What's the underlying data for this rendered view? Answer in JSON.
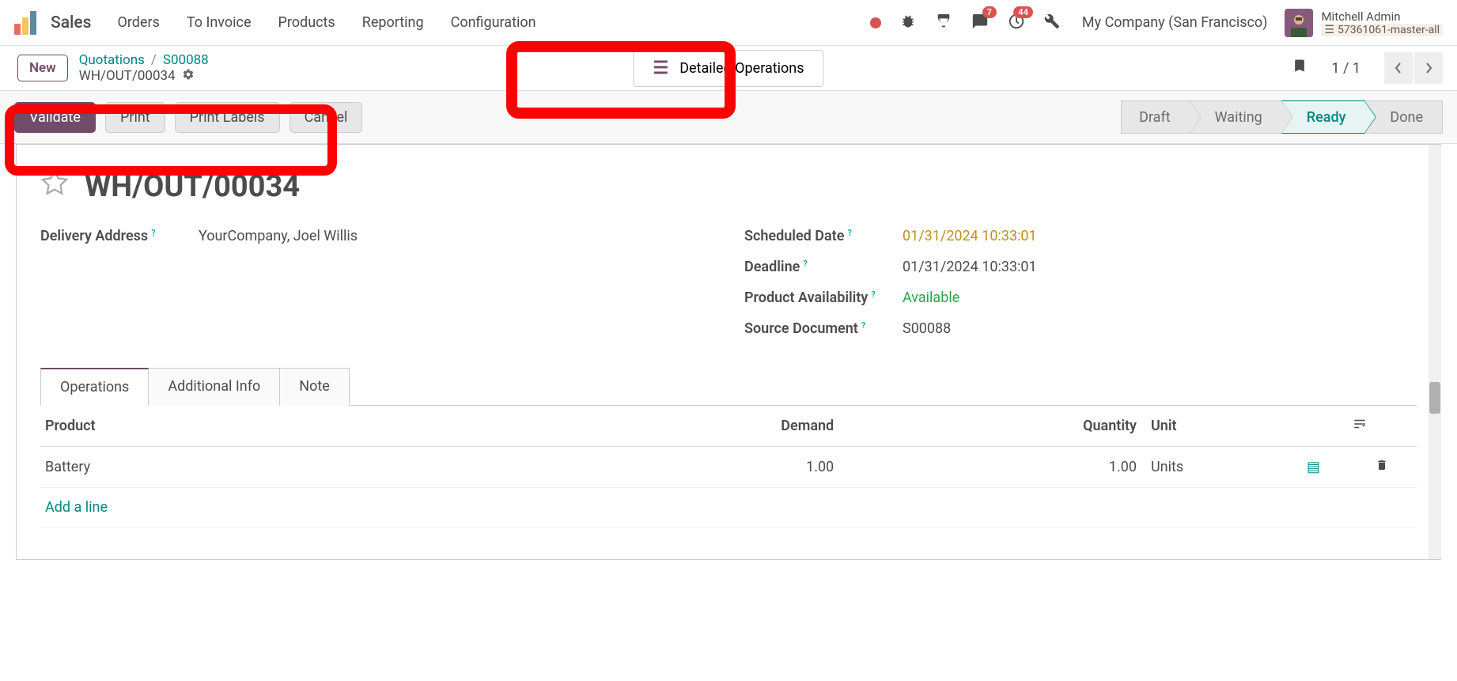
{
  "nav": {
    "app_title": "Sales",
    "menu": [
      "Orders",
      "To Invoice",
      "Products",
      "Reporting",
      "Configuration"
    ],
    "company": "My Company (San Francisco)",
    "badges": {
      "messaging": "7",
      "activities": "44"
    },
    "user": {
      "name": "Mitchell Admin",
      "db": "57361061-master-all"
    }
  },
  "control": {
    "new_btn": "New",
    "breadcrumb": {
      "quotations": "Quotations",
      "order": "S00088",
      "record": "WH/OUT/00034"
    },
    "stat_button": "Detailed Operations",
    "pager": "1 / 1"
  },
  "actions": {
    "validate": "Validate",
    "print": "Print",
    "print_labels": "Print Labels",
    "cancel": "Cancel"
  },
  "status": {
    "draft": "Draft",
    "waiting": "Waiting",
    "ready": "Ready",
    "done": "Done"
  },
  "form": {
    "title": "WH/OUT/00034",
    "delivery_address_label": "Delivery Address",
    "delivery_address": "YourCompany, Joel Willis",
    "scheduled_date_label": "Scheduled Date",
    "scheduled_date": "01/31/2024 10:33:01",
    "deadline_label": "Deadline",
    "deadline": "01/31/2024 10:33:01",
    "availability_label": "Product Availability",
    "availability": "Available",
    "source_label": "Source Document",
    "source": "S00088"
  },
  "tabs": {
    "operations": "Operations",
    "additional": "Additional Info",
    "note": "Note"
  },
  "table": {
    "headers": {
      "product": "Product",
      "demand": "Demand",
      "quantity": "Quantity",
      "unit": "Unit"
    },
    "rows": [
      {
        "product": "Battery",
        "demand": "1.00",
        "quantity": "1.00",
        "unit": "Units"
      }
    ],
    "add_line": "Add a line"
  }
}
